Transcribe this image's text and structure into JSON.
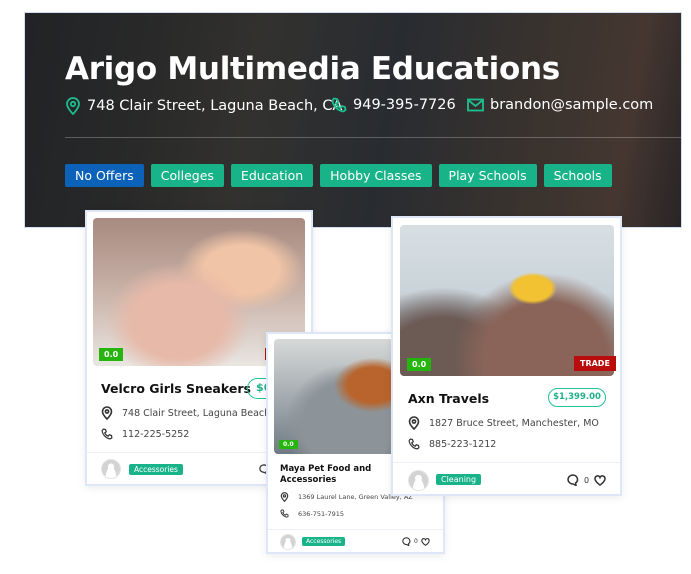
{
  "header": {
    "title": "Arigo Multimedia Educations",
    "address": "748 Clair Street, Laguna Beach, CA",
    "phone": "949-395-7726",
    "email": "brandon@sample.com",
    "tags": [
      "No Offers",
      "Colleges",
      "Education",
      "Hobby Classes",
      "Play Schools",
      "Schools"
    ]
  },
  "cards": [
    {
      "name": "Velcro Girls Sneakers",
      "price": "$6",
      "rating": "0.0",
      "address": "748 Clair Street, Laguna Beach, CA",
      "phone": "112-225-5252",
      "category": "Accessories"
    },
    {
      "name": "Maya Pet Food and Accessories",
      "rating": "0.0",
      "address": "1369 Laurel Lane, Green Valley, AZ",
      "phone": "636-751-7915",
      "category": "Accessories",
      "comments": "0"
    },
    {
      "name": "Axn Travels",
      "price": "$1,399.00",
      "rating": "0.0",
      "badge": "TRADE",
      "address": "1827 Bruce Street, Manchester, MO",
      "phone": "885-223-1212",
      "category": "Cleaning",
      "comments": "0"
    }
  ],
  "colors": {
    "accent": "#19b38a",
    "blue_tag": "#0b62b8",
    "rating": "#26b50e",
    "trade": "#b90d0d"
  }
}
